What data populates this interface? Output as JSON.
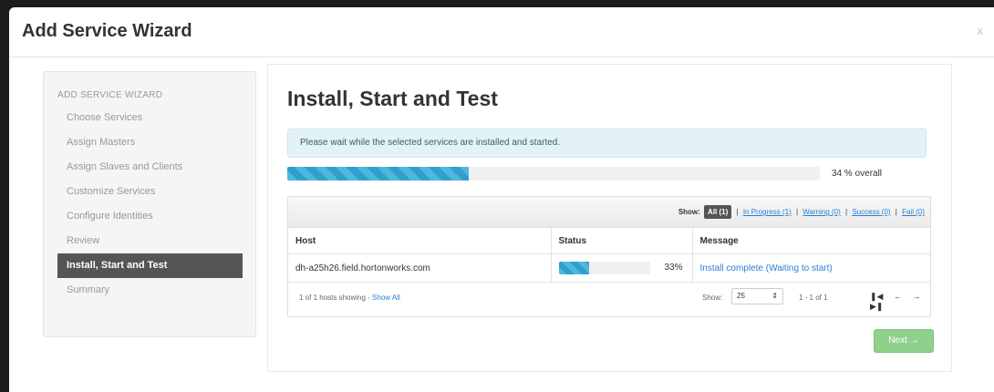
{
  "modal": {
    "title": "Add Service Wizard",
    "close_label": "x"
  },
  "sidebar": {
    "heading": "ADD SERVICE WIZARD",
    "items": [
      {
        "label": "Choose Services",
        "active": false
      },
      {
        "label": "Assign Masters",
        "active": false
      },
      {
        "label": "Assign Slaves and Clients",
        "active": false
      },
      {
        "label": "Customize Services",
        "active": false
      },
      {
        "label": "Configure Identities",
        "active": false
      },
      {
        "label": "Review",
        "active": false
      },
      {
        "label": "Install, Start and Test",
        "active": true
      },
      {
        "label": "Summary",
        "active": false
      }
    ]
  },
  "main": {
    "title": "Install, Start and Test",
    "alert": "Please wait while the selected services are installed and started.",
    "overall": {
      "percent": 34,
      "label": "34 % overall"
    }
  },
  "filters": {
    "show_label": "Show:",
    "all": "All (1)",
    "in_progress": "In Progress (1)",
    "warning": "Warning (0)",
    "success": "Success (0)",
    "fail": "Fail (0)",
    "separator": "|"
  },
  "table": {
    "headers": {
      "host": "Host",
      "status": "Status",
      "message": "Message"
    },
    "rows": [
      {
        "host": "dh-a25h26.field.hortonworks.com",
        "progress": 33,
        "percent": "33%",
        "message": "Install complete (Waiting to start)"
      }
    ],
    "footer": {
      "showing": "1 of 1 hosts showing - ",
      "show_all": "Show All",
      "show_label": "Show:",
      "page_size": "25",
      "range": "1 - 1 of 1"
    }
  },
  "next_button": "Next →",
  "icons": {
    "close": "close-icon",
    "first": "first-page-icon",
    "prev": "prev-page-icon",
    "next": "next-page-icon",
    "last": "last-page-icon"
  },
  "colors": {
    "progress": "#4fb7dc",
    "next_button": "#8fd18c",
    "active_nav": "#555555",
    "alert_bg": "#e3f2f7",
    "link": "#2a7fd4"
  }
}
